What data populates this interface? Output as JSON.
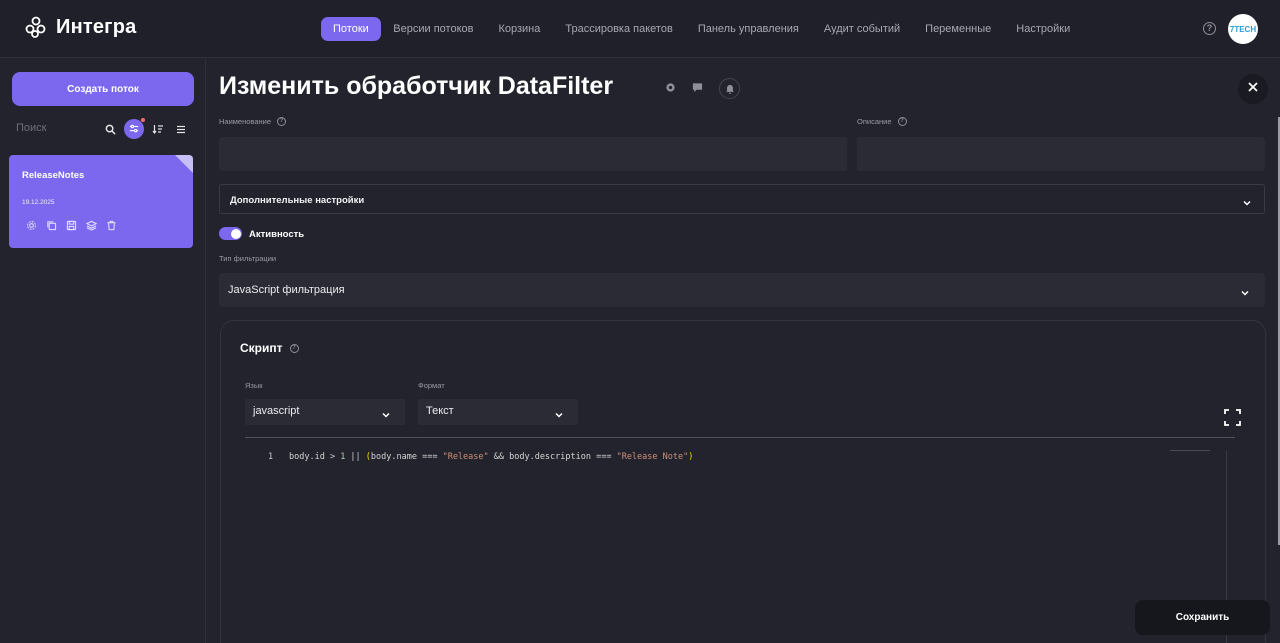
{
  "app": {
    "name": "Интегра",
    "avatar_text": "7TECH"
  },
  "nav": {
    "items": [
      {
        "label": "Потоки",
        "active": true
      },
      {
        "label": "Версии потоков",
        "active": false
      },
      {
        "label": "Корзина",
        "active": false
      },
      {
        "label": "Трассировка пакетов",
        "active": false
      },
      {
        "label": "Панель управления",
        "active": false
      },
      {
        "label": "Аудит событий",
        "active": false
      },
      {
        "label": "Переменные",
        "active": false
      },
      {
        "label": "Настройки",
        "active": false
      }
    ]
  },
  "sidebar": {
    "create_label": "Создать поток",
    "search_placeholder": "Поиск",
    "cards": [
      {
        "title": "ReleaseNotes",
        "date": "19.12.2025"
      }
    ]
  },
  "main": {
    "title": "Изменить обработчик DataFilter",
    "name_label": "Наименование",
    "name_value": "",
    "description_label": "Описание",
    "description_value": "",
    "advanced_label": "Дополнительные настройки",
    "active_label": "Активность",
    "active": true,
    "filter_type_label": "Тип фильтрации",
    "filter_type_value": "JavaScript фильтрация",
    "script": {
      "title": "Скрипт",
      "language_label": "Язык",
      "language_value": "javascript",
      "format_label": "Формат",
      "format_value": "Текст",
      "line_number": "1",
      "code_line": "body.id > 1 || (body.name === \"Release\" && body.description === \"Release Note\")"
    },
    "save_label": "Сохранить"
  },
  "colors": {
    "accent": "#7b68ee",
    "background": "#22232c",
    "input": "#2a2b34"
  }
}
